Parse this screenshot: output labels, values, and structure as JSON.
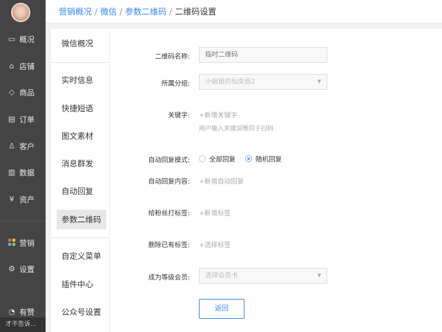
{
  "breadcrumb": {
    "items": [
      "营销概况",
      "微信",
      "参数二维码"
    ],
    "separator": "/",
    "current": "二维码设置"
  },
  "sidebar": {
    "items": [
      {
        "label": "概况",
        "icon": "monitor-icon"
      },
      {
        "label": "店铺",
        "icon": "store-icon"
      },
      {
        "label": "商品",
        "icon": "tag-icon"
      },
      {
        "label": "订单",
        "icon": "document-icon"
      },
      {
        "label": "客户",
        "icon": "user-icon"
      },
      {
        "label": "数据",
        "icon": "bar-chart-icon"
      },
      {
        "label": "资产",
        "icon": "yen-icon"
      },
      {
        "label": "营销",
        "icon": "colorful-dots-icon"
      },
      {
        "label": "设置",
        "icon": "gear-icon"
      },
      {
        "label": "有赞",
        "icon": "app-icon"
      }
    ],
    "footer": "才不告诉..."
  },
  "submenu": {
    "items": [
      "微信概况",
      "实时信息",
      "快捷短语",
      "图文素材",
      "消息群发",
      "自动回复",
      "参数二维码",
      "自定义菜单",
      "插件中心",
      "公众号设置"
    ],
    "active_index": 6
  },
  "form": {
    "qr_name": {
      "label": "二维码名称:",
      "placeholder": "临时二维码"
    },
    "group": {
      "label": "所属分组:",
      "value": "小姐姐的仙女组2"
    },
    "keyword": {
      "label": "关键字:",
      "add_link": "+新增关键字",
      "hint": "用户输入关键词等同于扫码"
    },
    "reply_mode": {
      "label": "自动回复模式:",
      "options": [
        "全部回复",
        "随机回复"
      ],
      "selected": "随机回复"
    },
    "reply_content": {
      "label": "自动回复内容:",
      "add_link": "+新增自动回复"
    },
    "fan_tag": {
      "label": "给粉丝打标签:",
      "add_link": "+新增标签"
    },
    "remove_tag": {
      "label": "删除已有标签:",
      "add_link": "+选择标签"
    },
    "member": {
      "label": "成为等级会员:",
      "placeholder": "选择会员卡"
    },
    "return_button": "返回"
  },
  "colors": {
    "sidebar_bg": "#444444",
    "link": "#3388ff",
    "radio_selected": "#7aa8e8"
  }
}
